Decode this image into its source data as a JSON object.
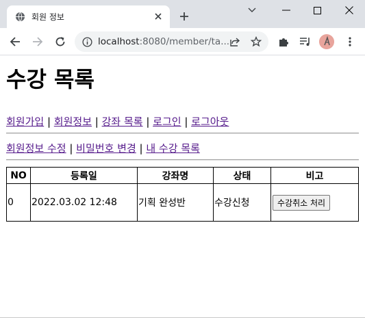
{
  "browser": {
    "tab_title": "회원 정보",
    "url_host": "localhost",
    "url_rest": ":8080/member/ta...",
    "avatar_initial": "a"
  },
  "page": {
    "title": "수강 목록",
    "nav_primary": [
      {
        "label": "회원가입"
      },
      {
        "label": "회원정보"
      },
      {
        "label": "강좌 목록"
      },
      {
        "label": "로그인"
      },
      {
        "label": "로그아웃"
      }
    ],
    "nav_secondary": [
      {
        "label": "회원정보 수정"
      },
      {
        "label": "비밀번호 변경"
      },
      {
        "label": "내 수강 목록"
      }
    ],
    "separator": " | ",
    "table": {
      "headers": [
        "NO",
        "등록일",
        "강좌명",
        "상태",
        "비고"
      ],
      "rows": [
        {
          "no": "0",
          "date": "2022.03.02 12:48",
          "course": "기획 완성반",
          "status": "수강신청",
          "action_label": "수강취소 처리"
        }
      ]
    }
  },
  "colors": {
    "tabstrip": "#dee1e6",
    "link_visited": "#551a8b",
    "omnibox": "#f1f3f4"
  }
}
